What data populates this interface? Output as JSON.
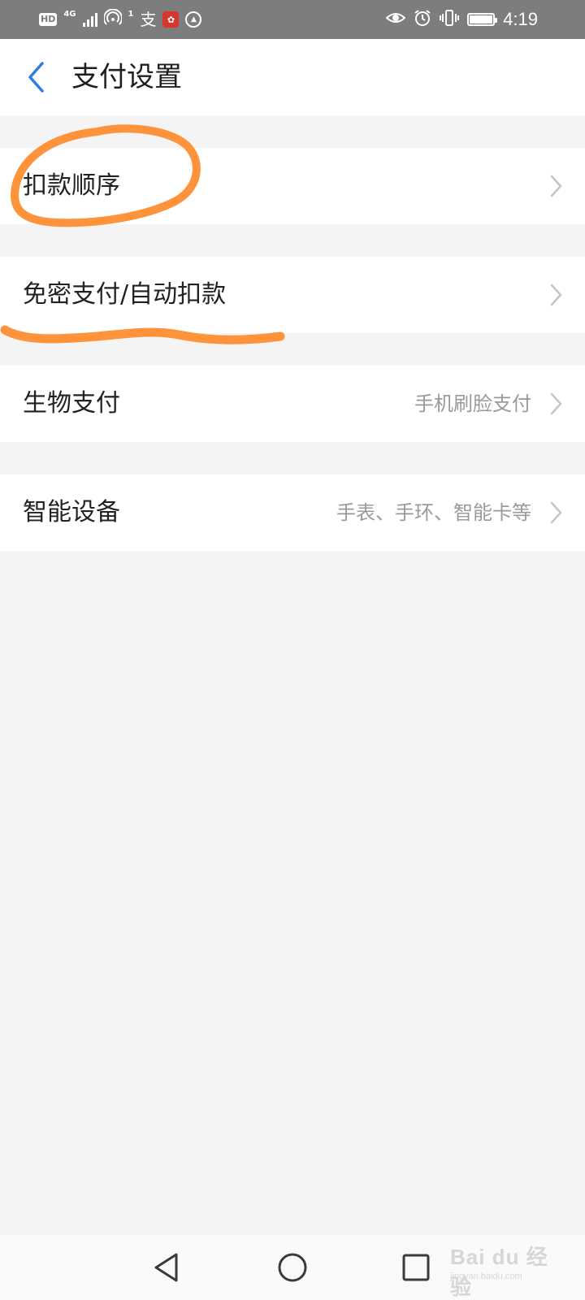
{
  "status_bar": {
    "hd": "HD",
    "network": "4G",
    "hotspot_count": "1",
    "alipay_glyph": "支",
    "time": "4:19",
    "icons": [
      "signal-icon",
      "hotspot-icon",
      "alipay-icon",
      "app-icon",
      "vpn-icon",
      "eye-icon",
      "alarm-icon",
      "vibrate-icon",
      "battery-icon"
    ]
  },
  "header": {
    "title": "支付设置"
  },
  "settings": [
    {
      "label": "扣款顺序",
      "value": ""
    },
    {
      "label": "免密支付/自动扣款",
      "value": ""
    },
    {
      "label": "生物支付",
      "value": "手机刷脸支付"
    },
    {
      "label": "智能设备",
      "value": "手表、手环、智能卡等"
    }
  ],
  "nav_bar": {
    "icons": [
      "back-triangle-icon",
      "home-circle-icon",
      "recents-square-icon"
    ]
  },
  "watermark": {
    "text": "Bai du 经验",
    "url": "jingyan.baidu.com"
  },
  "colors": {
    "status_bar": "#7d7d7d",
    "accent_blue": "#2f7de1",
    "annotation_orange": "#ff8a2b",
    "background": "#f4f4f4"
  }
}
